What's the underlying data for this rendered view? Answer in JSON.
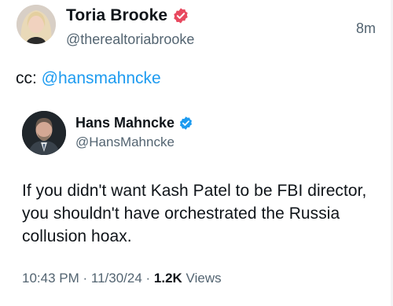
{
  "post": {
    "author_name": "Toria Brooke",
    "author_handle": "@therealtoriabrooke",
    "time_ago": "8m",
    "text_prefix": "cc: ",
    "mention": "@hansmahncke"
  },
  "quote": {
    "author_name": "Hans Mahncke",
    "author_handle": "@HansMahncke",
    "text": "If you didn't want Kash Patel to be FBI director, you shouldn't have orchestrated the Russia collusion hoax.",
    "time": "10:43 PM",
    "separator": " · ",
    "date": "11/30/24",
    "views_count": "1.2K",
    "views_label": " Views"
  },
  "colors": {
    "verified": "#1d9bf0",
    "link": "#1d9bf0",
    "secondary_text": "#536471",
    "primary_text": "#0f1419"
  },
  "icons": {
    "verified": "verified-badge-icon"
  }
}
